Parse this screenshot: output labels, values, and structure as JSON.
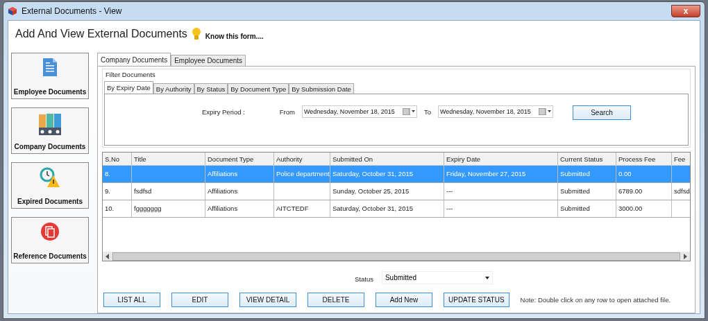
{
  "window": {
    "title": "External Documents - View",
    "close": "x"
  },
  "header": {
    "title": "Add And View External Documents",
    "help_link": "Know this form...."
  },
  "sidebar": {
    "items": [
      {
        "label": "Employee Documents",
        "selected": false
      },
      {
        "label": "Company Documents",
        "selected": false
      },
      {
        "label": "Expired Documents",
        "selected": false
      },
      {
        "label": "Reference Documents",
        "selected": false
      }
    ]
  },
  "tabs": [
    {
      "label": "Company Documents",
      "selected": true
    },
    {
      "label": "Employee Documents",
      "selected": false
    }
  ],
  "filter": {
    "title": "Filter Documents",
    "tabs": [
      {
        "label": "By Expiry Date",
        "selected": true
      },
      {
        "label": "By Authority",
        "selected": false
      },
      {
        "label": "By Status",
        "selected": false
      },
      {
        "label": "By Document Type",
        "selected": false
      },
      {
        "label": "By Submission Date",
        "selected": false
      }
    ],
    "period_label": "Expiry Period :",
    "from_label": "From",
    "from_value": "Wednesday, November 18, 2015",
    "to_label": "To",
    "to_value": "Wednesday, November 18, 2015",
    "search_button": "Search"
  },
  "table": {
    "columns": [
      "S.No",
      "Title",
      "Document Type",
      "Authority",
      "Submitted On",
      "Expiry Date",
      "Current Status",
      "Process Fee",
      "Fee"
    ],
    "rows": [
      {
        "selected": true,
        "cells": [
          "8.",
          "",
          "Affiliations",
          "Police department",
          "Saturday, October 31, 2015",
          "Friday, November 27, 2015",
          "Submitted",
          "0.00",
          ""
        ]
      },
      {
        "selected": false,
        "cells": [
          "9.",
          "fsdfsd",
          "Affiliations",
          "",
          "Sunday, October 25, 2015",
          "---",
          "Submitted",
          "6789.00",
          "sdfsd"
        ]
      },
      {
        "selected": false,
        "cells": [
          "10.",
          "fggggggg",
          "Affiliations",
          "AITCTEDF",
          "Saturday, October 31, 2015",
          "---",
          "Submitted",
          "3000.00",
          ""
        ]
      }
    ]
  },
  "status": {
    "label": "Status",
    "value": "Submitted"
  },
  "buttons": [
    "LIST ALL",
    "EDIT",
    "VIEW DETAIL",
    "DELETE",
    "Add New",
    "UPDATE STATUS"
  ],
  "note": "Note: Double click on any row to open attached file."
}
